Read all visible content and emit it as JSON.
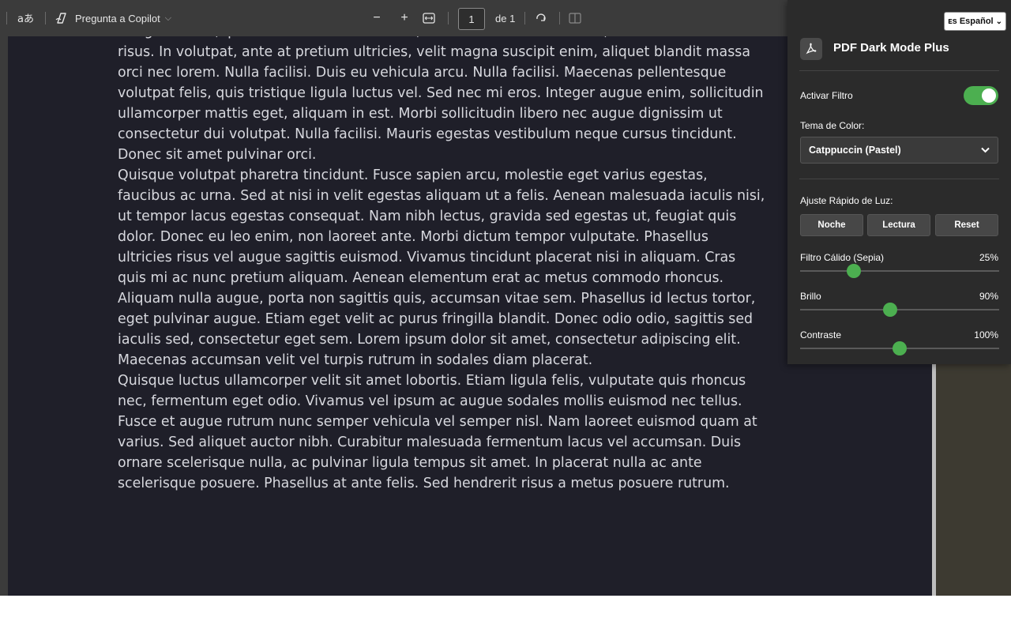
{
  "toolbar": {
    "read_aloud_icon": "read-aloud-icon",
    "copilot_label": "Pregunta a Copilot",
    "zoom_out": "−",
    "zoom_in": "+",
    "page_number": "1",
    "page_total": "de 1"
  },
  "document": {
    "lines": [
      "Integer mattis, ipsum a tincidunt commodo, lacus arcu elementum elit, at mollis eros ante",
      "risus. In volutpat, ante at pretium ultricies, velit magna suscipit enim, aliquet blandit massa",
      "orci nec lorem. Nulla facilisi. Duis eu vehicula arcu. Nulla facilisi. Maecenas pellentesque",
      "volutpat felis, quis tristique ligula luctus vel. Sed nec mi eros. Integer augue enim, sollicitudin",
      "ullamcorper mattis eget, aliquam in est. Morbi sollicitudin libero nec augue dignissim ut",
      "consectetur dui volutpat. Nulla facilisi. Mauris egestas vestibulum neque cursus tincidunt.",
      "Donec sit amet pulvinar orci.",
      "Quisque volutpat pharetra tincidunt. Fusce sapien arcu, molestie eget varius egestas,",
      "faucibus ac urna. Sed at nisi in velit egestas aliquam ut a felis. Aenean malesuada iaculis nisi,",
      "ut tempor lacus egestas consequat. Nam nibh lectus, gravida sed egestas ut, feugiat quis",
      "dolor. Donec eu leo enim, non laoreet ante. Morbi dictum tempor vulputate. Phasellus",
      "ultricies risus vel augue sagittis euismod. Vivamus tincidunt placerat nisi in aliquam. Cras",
      "quis mi ac nunc pretium aliquam. Aenean elementum erat ac metus commodo rhoncus.",
      "Aliquam nulla augue, porta non sagittis quis, accumsan vitae sem. Phasellus id lectus tortor,",
      "eget pulvinar augue. Etiam eget velit ac purus fringilla blandit. Donec odio odio, sagittis sed",
      "iaculis sed, consectetur eget sem. Lorem ipsum dolor sit amet, consectetur adipiscing elit.",
      "Maecenas accumsan velit vel turpis rutrum in sodales diam placerat.",
      "Quisque luctus ullamcorper velit sit amet lobortis. Etiam ligula felis, vulputate quis rhoncus",
      "nec, fermentum eget odio. Vivamus vel ipsum ac augue sodales mollis euismod nec tellus.",
      "Fusce et augue rutrum nunc semper vehicula vel semper nisl. Nam laoreet euismod quam at",
      "varius. Sed aliquet auctor nibh. Curabitur malesuada fermentum lacus vel accumsan. Duis",
      "ornare scelerisque nulla, ac pulvinar ligula tempus sit amet. In placerat nulla ac ante",
      "scelerisque posuere. Phasellus at ante felis. Sed hendrerit risus a metus posuere rutrum."
    ]
  },
  "popup": {
    "language": "ᴇs Español",
    "title": "PDF Dark Mode Plus",
    "filter_label": "Activar Filtro",
    "filter_enabled": true,
    "theme_label": "Tema de Color:",
    "theme_value": "Catppuccin (Pastel)",
    "quick_label": "Ajuste Rápido de Luz:",
    "quick_buttons": [
      "Noche",
      "Lectura",
      "Reset"
    ],
    "sliders": [
      {
        "label": "Filtro Cálido (Sepia)",
        "value_text": "25%",
        "value": 25
      },
      {
        "label": "Brillo",
        "value_text": "90%",
        "value": 90
      },
      {
        "label": "Contraste",
        "value_text": "100%",
        "value": 100
      }
    ],
    "accent_color": "#4caf50"
  }
}
